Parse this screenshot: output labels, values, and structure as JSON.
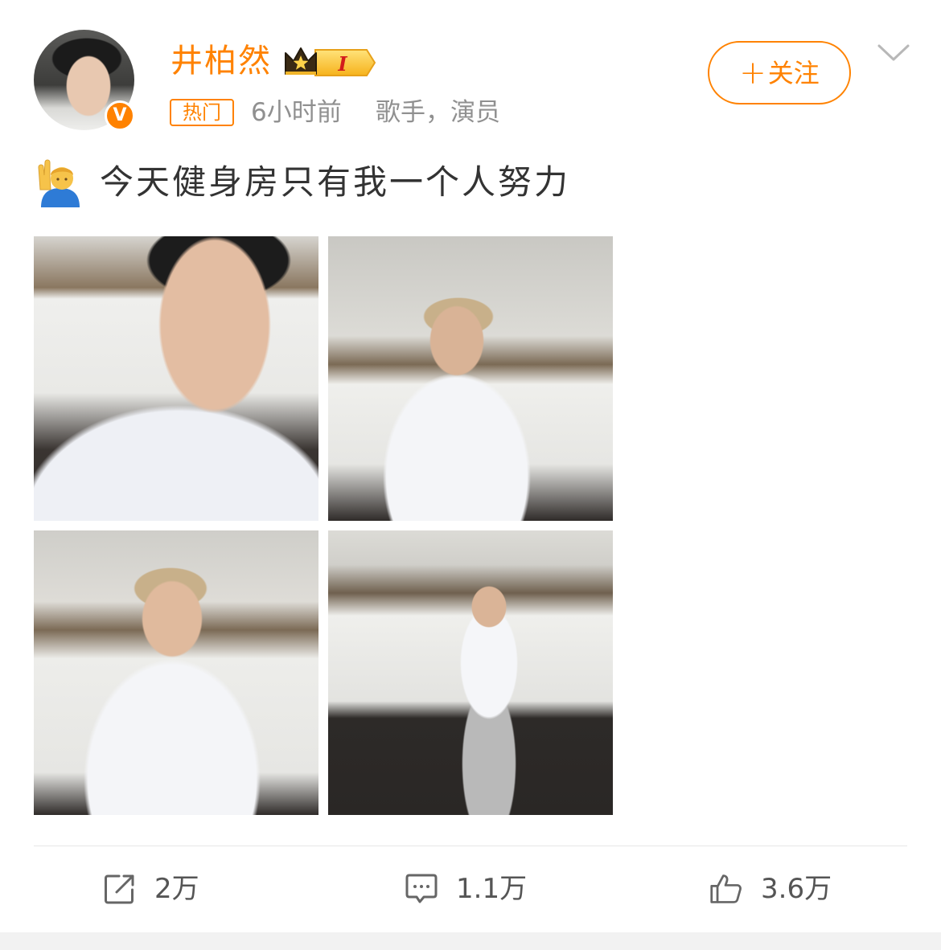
{
  "user": {
    "name": "井柏然",
    "verified_badge": "V",
    "level_badge": "I",
    "hot_tag": "热门",
    "time": "6小时前",
    "source": "歌手，演员"
  },
  "follow": {
    "plus": "+",
    "label": "关注"
  },
  "post": {
    "caption": "今天健身房只有我一个人努力"
  },
  "actions": {
    "repost_count": "2万",
    "comment_count": "1.1万",
    "like_count": "3.6万"
  },
  "colors": {
    "accent": "#ff8200",
    "text": "#333333",
    "meta": "#909090"
  },
  "icons": [
    "chevron-down-icon",
    "raising-hand-emoji-icon",
    "share-icon",
    "comment-icon",
    "thumbs-up-icon",
    "crown-icon"
  ]
}
